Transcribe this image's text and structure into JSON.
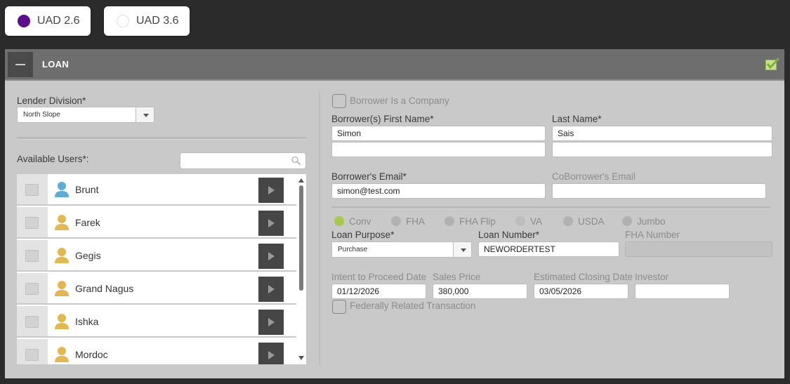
{
  "uad": {
    "options": [
      {
        "label": "UAD 2.6",
        "selected": true
      },
      {
        "label": "UAD 3.6",
        "selected": false
      }
    ],
    "selected_color": "#5c0c8c"
  },
  "section": {
    "title": "LOAN",
    "complete_color": "#8bc34a"
  },
  "lender_division": {
    "label": "Lender Division*",
    "value": "North Slope"
  },
  "available_users": {
    "label": "Available Users*:",
    "search_placeholder": "",
    "users": [
      {
        "name": "Brunt",
        "icon": "user-icon-blue"
      },
      {
        "name": "Farek",
        "icon": "user-icon-gold"
      },
      {
        "name": "Gegis",
        "icon": "user-icon-gold"
      },
      {
        "name": "Grand Nagus",
        "icon": "user-icon-gold"
      },
      {
        "name": "Ishka",
        "icon": "user-icon-gold"
      },
      {
        "name": "Mordoc",
        "icon": "user-icon-gold"
      }
    ]
  },
  "borrower": {
    "is_company_label": "Borrower Is a Company",
    "first_name_label": "Borrower(s) First Name*",
    "first_name": "Simon",
    "first_name_2": "",
    "last_name_label": "Last Name*",
    "last_name": "Sais",
    "last_name_2": "",
    "email_label": "Borrower's Email*",
    "email": "simon@test.com",
    "coborrower_email_label": "CoBorrower's Email",
    "coborrower_email": ""
  },
  "loan_type": {
    "options": [
      "Conv",
      "FHA",
      "FHA Flip",
      "VA",
      "USDA",
      "Jumbo"
    ],
    "selected": "Conv"
  },
  "loan": {
    "purpose_label": "Loan Purpose*",
    "purpose": "Purchase",
    "number_label": "Loan Number*",
    "number": "NEWORDERTEST",
    "fha_label": "FHA Number",
    "fha": "",
    "intent_label": "Intent to Proceed Date",
    "intent": "01/12/2026",
    "sales_price_label": "Sales Price",
    "sales_price": "380,000",
    "closing_label": "Estimated Closing Date",
    "closing": "03/05/2026",
    "investor_label": "Investor",
    "investor": "",
    "federally_related_label": "Federally Related Transaction"
  }
}
